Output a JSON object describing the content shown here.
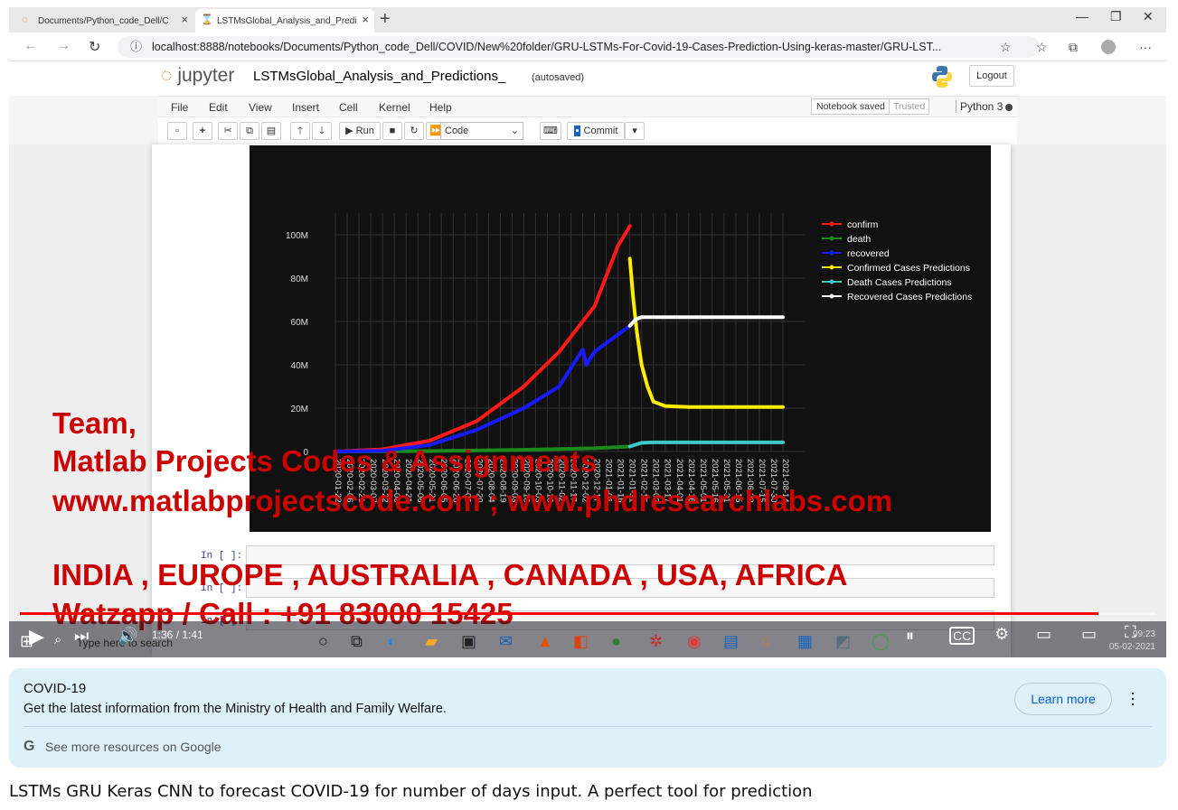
{
  "browser": {
    "tab1_title": "Documents/Python_code_Dell/C",
    "tab2_title": "LSTMsGlobal_Analysis_and_Predi",
    "url": "localhost:8888/notebooks/Documents/Python_code_Dell/COVID/New%20folder/GRU-LSTMs-For-Covid-19-Cases-Prediction-Using-keras-master/GRU-LST..."
  },
  "jupyter": {
    "logo": "jupyter",
    "notebook_title": "LSTMsGlobal_Analysis_and_Predictions_",
    "autosave": "(autosaved)",
    "logout": "Logout",
    "menu": [
      "File",
      "Edit",
      "View",
      "Insert",
      "Cell",
      "Kernel",
      "Help"
    ],
    "notebook_saved": "Notebook saved",
    "trusted": "Trusted",
    "kernel": "Python 3",
    "toolbar": {
      "run": "Run",
      "cell_type": "Code",
      "commit": "Commit"
    },
    "in_prompt": "In [ ]:"
  },
  "chart_data": {
    "type": "line",
    "y_ticks": [
      "100M",
      "80M",
      "60M",
      "40M",
      "20M",
      "0"
    ],
    "ylim": [
      0,
      110000000
    ],
    "x_ticks": [
      "2020-01-22",
      "2020-02-06",
      "2020-02-21",
      "2020-03-07",
      "2020-03-22",
      "2020-04-06",
      "2020-04-21",
      "2020-05-06",
      "2020-05-21",
      "2020-06-05",
      "2020-06-20",
      "2020-07-05",
      "2020-07-20",
      "2020-08-04",
      "2020-08-19",
      "2020-09-03",
      "2020-09-18",
      "2020-10-03",
      "2020-10-18",
      "2020-11-02",
      "2020-11-17",
      "2020-12-02",
      "2020-12-17",
      "2021-01-01",
      "2021-01-16",
      "2021-01-31",
      "2021-02-15",
      "2021-03-02",
      "2021-03-17",
      "2021-04-01",
      "2021-04-16",
      "2021-05-01",
      "2021-05-16",
      "2021-05-31",
      "2021-06-15",
      "2021-06-30",
      "2021-07-15",
      "2021-07-30",
      "2021-08-14"
    ],
    "series": [
      {
        "name": "confirm",
        "color": "#ff1a1a",
        "x_index": [
          0,
          4,
          8,
          12,
          16,
          19,
          22,
          24,
          25
        ],
        "values": [
          0,
          1000000,
          5000000,
          14000000,
          30000000,
          46000000,
          67000000,
          95000000,
          104000000
        ]
      },
      {
        "name": "death",
        "color": "#1a8a1a",
        "x_index": [
          0,
          8,
          16,
          22,
          25
        ],
        "values": [
          0,
          200000,
          800000,
          1500000,
          2300000
        ]
      },
      {
        "name": "recovered",
        "color": "#1a1aff",
        "x_index": [
          0,
          4,
          8,
          12,
          16,
          19,
          21,
          21.3,
          22,
          24,
          25
        ],
        "values": [
          0,
          300000,
          3000000,
          10000000,
          20000000,
          30000000,
          47000000,
          40000000,
          46000000,
          54000000,
          58000000
        ]
      },
      {
        "name": "Confirmed Cases Predictions",
        "color": "#ffee00",
        "x_index": [
          25,
          25.3,
          25.6,
          26,
          26.5,
          27,
          28,
          30,
          33,
          38
        ],
        "values": [
          89000000,
          70000000,
          55000000,
          40000000,
          30000000,
          23000000,
          21000000,
          20500000,
          20500000,
          20500000
        ]
      },
      {
        "name": "Death Cases Predictions",
        "color": "#3ec8c8",
        "x_index": [
          25,
          26,
          27,
          30,
          38
        ],
        "values": [
          2300000,
          4000000,
          4200000,
          4200000,
          4200000
        ]
      },
      {
        "name": "Recovered Cases Predictions",
        "color": "#ffffff",
        "x_index": [
          25,
          25.5,
          26,
          27,
          30,
          38
        ],
        "values": [
          58000000,
          61000000,
          62000000,
          62000000,
          62000000,
          62000000
        ]
      }
    ],
    "legend_position": "top-right"
  },
  "overlay": {
    "line1": "Team,",
    "line2": "Matlab Projects Codes & Assignments",
    "line3": "www.matlabprojectscode.com ; www.phdresearchlabs.com",
    "line4": "INDIA , EUROPE , AUSTRALIA , CANADA , USA, AFRICA",
    "line5": "Watzapp / Call : +91 83000 15425"
  },
  "player": {
    "time": "1:36 / 1:41",
    "progress": 0.95
  },
  "taskbar": {
    "search": "Type here to search",
    "clock_time": "09:23",
    "clock_date": "05-02-2021"
  },
  "info_card": {
    "title": "COVID-19",
    "subtitle": "Get the latest information from the Ministry of Health and Family Welfare.",
    "button": "Learn more",
    "footer": "See more resources on Google"
  },
  "video_title": "LSTMs GRU Keras CNN to forecast COVID-19 for number of days input. A perfect tool for prediction"
}
